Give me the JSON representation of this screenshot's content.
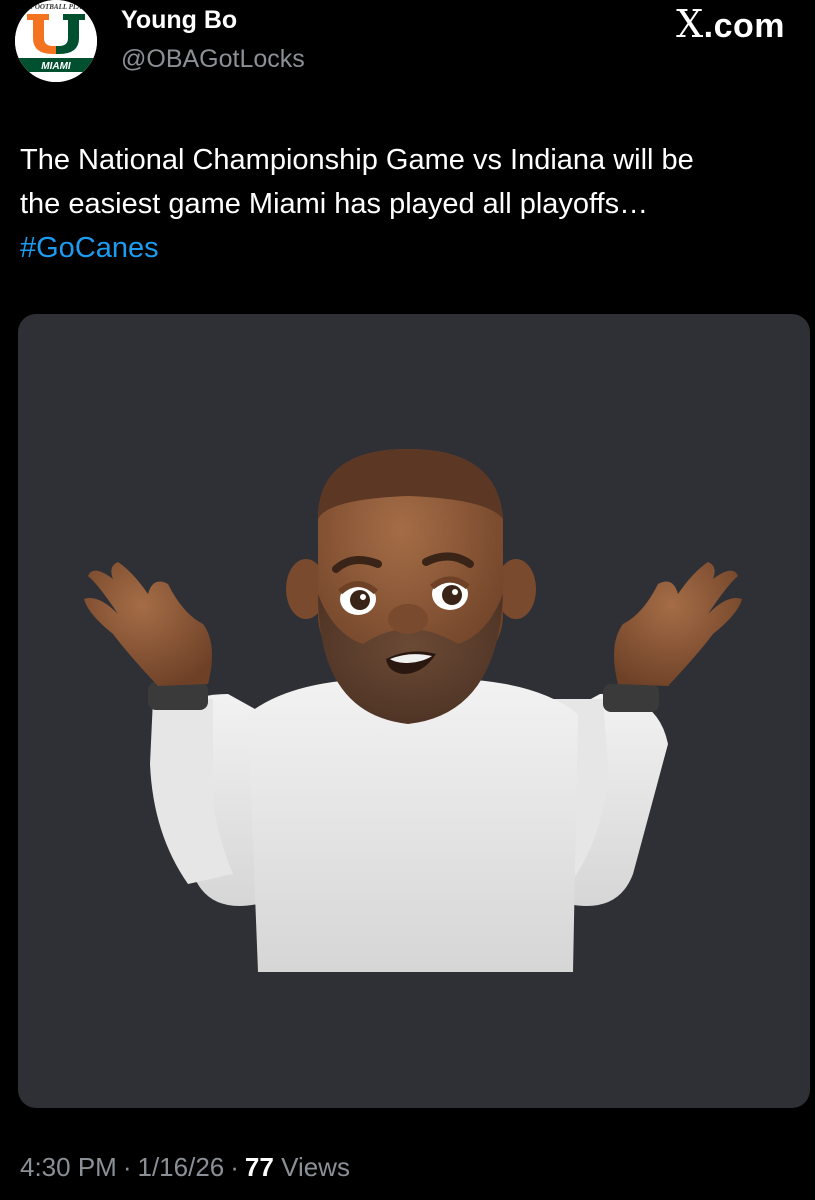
{
  "post": {
    "author": {
      "display_name": "Young Bo",
      "handle": "@OBAGotLocks",
      "avatar": {
        "label": "MIAMI",
        "top_text": "FOOTBALL PLA",
        "colors": {
          "orange": "#f47321",
          "green": "#005030"
        }
      }
    },
    "brand": {
      "letter": "X",
      "suffix": ".com"
    },
    "text": {
      "line1": "The National Championship Game vs Indiana will be",
      "line2": "the easiest game Miami has played all playoffs…",
      "hashtag": "#GoCanes"
    },
    "media": {
      "icon": "shrug-memoji-icon",
      "background": "#2f3035"
    },
    "meta": {
      "time": "4:30 PM",
      "date": "1/16/26",
      "separator": "·",
      "views_count": "77",
      "views_label": "Views"
    }
  },
  "colors": {
    "background": "#000000",
    "text_primary": "#ffffff",
    "text_secondary": "#8b9096",
    "link": "#1d9bf0"
  }
}
